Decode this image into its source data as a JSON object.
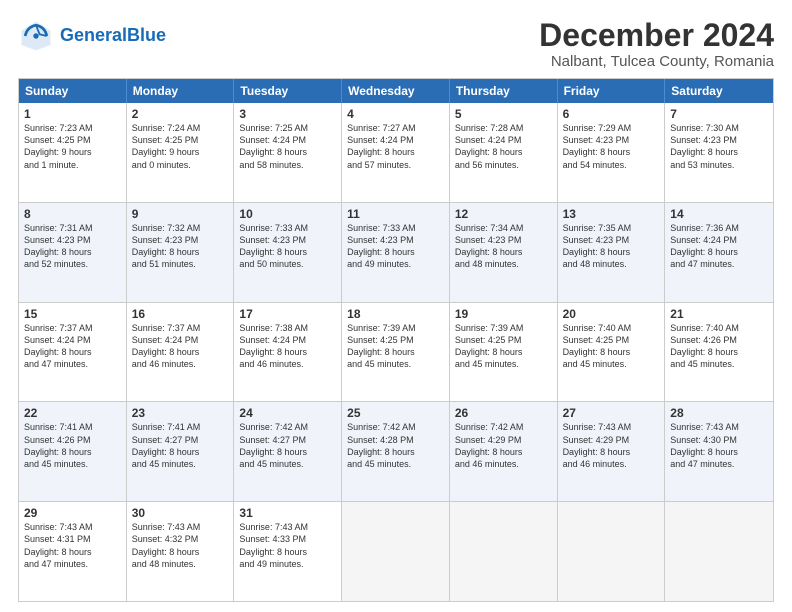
{
  "header": {
    "logo_general": "General",
    "logo_blue": "Blue",
    "main_title": "December 2024",
    "sub_title": "Nalbant, Tulcea County, Romania"
  },
  "days_of_week": [
    "Sunday",
    "Monday",
    "Tuesday",
    "Wednesday",
    "Thursday",
    "Friday",
    "Saturday"
  ],
  "weeks": [
    [
      {
        "day": "1",
        "lines": [
          "Sunrise: 7:23 AM",
          "Sunset: 4:25 PM",
          "Daylight: 9 hours",
          "and 1 minute."
        ]
      },
      {
        "day": "2",
        "lines": [
          "Sunrise: 7:24 AM",
          "Sunset: 4:25 PM",
          "Daylight: 9 hours",
          "and 0 minutes."
        ]
      },
      {
        "day": "3",
        "lines": [
          "Sunrise: 7:25 AM",
          "Sunset: 4:24 PM",
          "Daylight: 8 hours",
          "and 58 minutes."
        ]
      },
      {
        "day": "4",
        "lines": [
          "Sunrise: 7:27 AM",
          "Sunset: 4:24 PM",
          "Daylight: 8 hours",
          "and 57 minutes."
        ]
      },
      {
        "day": "5",
        "lines": [
          "Sunrise: 7:28 AM",
          "Sunset: 4:24 PM",
          "Daylight: 8 hours",
          "and 56 minutes."
        ]
      },
      {
        "day": "6",
        "lines": [
          "Sunrise: 7:29 AM",
          "Sunset: 4:23 PM",
          "Daylight: 8 hours",
          "and 54 minutes."
        ]
      },
      {
        "day": "7",
        "lines": [
          "Sunrise: 7:30 AM",
          "Sunset: 4:23 PM",
          "Daylight: 8 hours",
          "and 53 minutes."
        ]
      }
    ],
    [
      {
        "day": "8",
        "lines": [
          "Sunrise: 7:31 AM",
          "Sunset: 4:23 PM",
          "Daylight: 8 hours",
          "and 52 minutes."
        ]
      },
      {
        "day": "9",
        "lines": [
          "Sunrise: 7:32 AM",
          "Sunset: 4:23 PM",
          "Daylight: 8 hours",
          "and 51 minutes."
        ]
      },
      {
        "day": "10",
        "lines": [
          "Sunrise: 7:33 AM",
          "Sunset: 4:23 PM",
          "Daylight: 8 hours",
          "and 50 minutes."
        ]
      },
      {
        "day": "11",
        "lines": [
          "Sunrise: 7:33 AM",
          "Sunset: 4:23 PM",
          "Daylight: 8 hours",
          "and 49 minutes."
        ]
      },
      {
        "day": "12",
        "lines": [
          "Sunrise: 7:34 AM",
          "Sunset: 4:23 PM",
          "Daylight: 8 hours",
          "and 48 minutes."
        ]
      },
      {
        "day": "13",
        "lines": [
          "Sunrise: 7:35 AM",
          "Sunset: 4:23 PM",
          "Daylight: 8 hours",
          "and 48 minutes."
        ]
      },
      {
        "day": "14",
        "lines": [
          "Sunrise: 7:36 AM",
          "Sunset: 4:24 PM",
          "Daylight: 8 hours",
          "and 47 minutes."
        ]
      }
    ],
    [
      {
        "day": "15",
        "lines": [
          "Sunrise: 7:37 AM",
          "Sunset: 4:24 PM",
          "Daylight: 8 hours",
          "and 47 minutes."
        ]
      },
      {
        "day": "16",
        "lines": [
          "Sunrise: 7:37 AM",
          "Sunset: 4:24 PM",
          "Daylight: 8 hours",
          "and 46 minutes."
        ]
      },
      {
        "day": "17",
        "lines": [
          "Sunrise: 7:38 AM",
          "Sunset: 4:24 PM",
          "Daylight: 8 hours",
          "and 46 minutes."
        ]
      },
      {
        "day": "18",
        "lines": [
          "Sunrise: 7:39 AM",
          "Sunset: 4:25 PM",
          "Daylight: 8 hours",
          "and 45 minutes."
        ]
      },
      {
        "day": "19",
        "lines": [
          "Sunrise: 7:39 AM",
          "Sunset: 4:25 PM",
          "Daylight: 8 hours",
          "and 45 minutes."
        ]
      },
      {
        "day": "20",
        "lines": [
          "Sunrise: 7:40 AM",
          "Sunset: 4:25 PM",
          "Daylight: 8 hours",
          "and 45 minutes."
        ]
      },
      {
        "day": "21",
        "lines": [
          "Sunrise: 7:40 AM",
          "Sunset: 4:26 PM",
          "Daylight: 8 hours",
          "and 45 minutes."
        ]
      }
    ],
    [
      {
        "day": "22",
        "lines": [
          "Sunrise: 7:41 AM",
          "Sunset: 4:26 PM",
          "Daylight: 8 hours",
          "and 45 minutes."
        ]
      },
      {
        "day": "23",
        "lines": [
          "Sunrise: 7:41 AM",
          "Sunset: 4:27 PM",
          "Daylight: 8 hours",
          "and 45 minutes."
        ]
      },
      {
        "day": "24",
        "lines": [
          "Sunrise: 7:42 AM",
          "Sunset: 4:27 PM",
          "Daylight: 8 hours",
          "and 45 minutes."
        ]
      },
      {
        "day": "25",
        "lines": [
          "Sunrise: 7:42 AM",
          "Sunset: 4:28 PM",
          "Daylight: 8 hours",
          "and 45 minutes."
        ]
      },
      {
        "day": "26",
        "lines": [
          "Sunrise: 7:42 AM",
          "Sunset: 4:29 PM",
          "Daylight: 8 hours",
          "and 46 minutes."
        ]
      },
      {
        "day": "27",
        "lines": [
          "Sunrise: 7:43 AM",
          "Sunset: 4:29 PM",
          "Daylight: 8 hours",
          "and 46 minutes."
        ]
      },
      {
        "day": "28",
        "lines": [
          "Sunrise: 7:43 AM",
          "Sunset: 4:30 PM",
          "Daylight: 8 hours",
          "and 47 minutes."
        ]
      }
    ],
    [
      {
        "day": "29",
        "lines": [
          "Sunrise: 7:43 AM",
          "Sunset: 4:31 PM",
          "Daylight: 8 hours",
          "and 47 minutes."
        ]
      },
      {
        "day": "30",
        "lines": [
          "Sunrise: 7:43 AM",
          "Sunset: 4:32 PM",
          "Daylight: 8 hours",
          "and 48 minutes."
        ]
      },
      {
        "day": "31",
        "lines": [
          "Sunrise: 7:43 AM",
          "Sunset: 4:33 PM",
          "Daylight: 8 hours",
          "and 49 minutes."
        ]
      },
      {
        "day": "",
        "lines": []
      },
      {
        "day": "",
        "lines": []
      },
      {
        "day": "",
        "lines": []
      },
      {
        "day": "",
        "lines": []
      }
    ]
  ]
}
